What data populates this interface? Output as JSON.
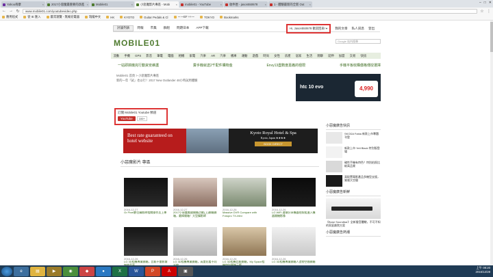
{
  "browser": {
    "tabs": [
      {
        "label": "Yahoo奇摩",
        "color": "#6b2fa0",
        "active": false
      },
      {
        "label": "2017小惡魔最重要的改進",
        "color": "#4e7a2e",
        "active": false
      },
      {
        "label": "Mobile01",
        "color": "#4e7a2e",
        "active": false
      },
      {
        "label": "小惡魔影片專區 - Mobi",
        "color": "#4e7a2e",
        "active": true
      },
      {
        "label": "mobile01 - YouTube",
        "color": "#c4302b",
        "active": false
      },
      {
        "label": "收件匣 - jason550678",
        "color": "#c4302b",
        "active": false
      },
      {
        "label": "1 - 體驗最新的全新 Out",
        "color": "#c4302b",
        "active": false
      }
    ],
    "url": "www.mobile01.com/youtubevideo.php",
    "bookmarks": [
      "應用程式",
      "從 IE 匯入",
      "最常瀏覽 - 無線充電器",
      "瑞龍中文",
      "HK",
      "KYOTO",
      "Guitar Pedals & Cl",
      "ーーEF ++ー",
      "TOKYO",
      "Bookmarks"
    ]
  },
  "site": {
    "topnav": [
      "討論列表",
      "問報",
      "市集",
      "群組",
      "問題日本",
      "APP下載"
    ],
    "topnav_selected": "討論列表",
    "user": "Hi, Jason550678 歡迎回來! ▾",
    "rightnav": [
      "我的文章",
      "私人訊息",
      "登出"
    ],
    "logo": "MOBILE01",
    "search_placeholder": "Google 站內搜尋",
    "categories": [
      "流動",
      "手機",
      "GPS",
      "影音",
      "筆電",
      "電腦",
      "相機",
      "家電",
      "汽車",
      "AR",
      "汽車",
      "機車",
      "運動",
      "遊戲",
      "時尚",
      "女性",
      "房產",
      "居家",
      "生活",
      "閒聊",
      "延伸",
      "加盟",
      "交易",
      "快訊"
    ],
    "promos": [
      "一站即搞機完行動資安維護",
      "賣手機就送2千配件購物金",
      "Envy13盡數度嘉義的極限",
      "手機平板收購價格傳授選擇"
    ],
    "breadcrumb": "Mobile01 首頁 > 小惡魔影片專區",
    "subcrumb": "新的一年「試」也以行！2017 New Outlander 48小時試用體驗",
    "subscribe": {
      "label": "訂閱 Mobile01 Youtube 頻道",
      "button": "YouTube",
      "count": "100+"
    },
    "ad_banner": {
      "left": "Best rate guaranteed on hotel website",
      "title": "Kyoto Royal Hotel & Spa",
      "sub": "Kyoto, Japan ★★★★",
      "cta": "BOOK DIRECT"
    },
    "htc_ad": {
      "brand": "htc 10 evo",
      "price": "4,990"
    },
    "section_title": "小惡魔影片 專區",
    "videos": [
      {
        "date": "2016-12-27",
        "title": "Gr Pixel數位攝影師相關操作及上專"
      },
      {
        "date": "2016-12-27",
        "title": "2017小惡魔美國開箱活動(上)開箱開箱，最棒開箱！大型攝影師"
      },
      {
        "date": "2016-12-26",
        "title": "Massive DVR Compare with Fotopro TX-Mini"
      },
      {
        "date": "2016-12-26",
        "title": "LG WiFi 遠端分享機器拍照組進入機器開機影像"
      },
      {
        "date": "2016-12-26",
        "title": "LG 3D相機專業開箱，比較不會影響無線音率"
      },
      {
        "date": "2016-12-26",
        "title": "LG 3D相機專業開箱，高度化看不同光線"
      },
      {
        "date": "2016-12-26",
        "title": "LG 3D相機比較開箱，My Space相機特別開箱示範"
      },
      {
        "date": "2016-12-26",
        "title": "LG 3D相機專業開箱人造物空間開箱"
      }
    ],
    "sidebar": {
      "title": "小惡魔廣告快訊",
      "items": [
        {
          "text": "SKODA Fabia 新款上市專題刊登"
        },
        {
          "text": "新款上市 Yeti Black 特別版登場"
        },
        {
          "text": "確性手機有特色？特別拍照比較高品質"
        },
        {
          "text": "高配置電影產品多機型支援，質感大空間"
        }
      ],
      "title2": "小惡魔廣告新鮮",
      "item2": "《Bose Soundbar》全新聲音體驗，不可不知的家庭劇院方案",
      "title3": "小惡魔廣告熱潮"
    }
  },
  "os": {
    "time": "上午 08:20",
    "date": "2016/12/28"
  }
}
